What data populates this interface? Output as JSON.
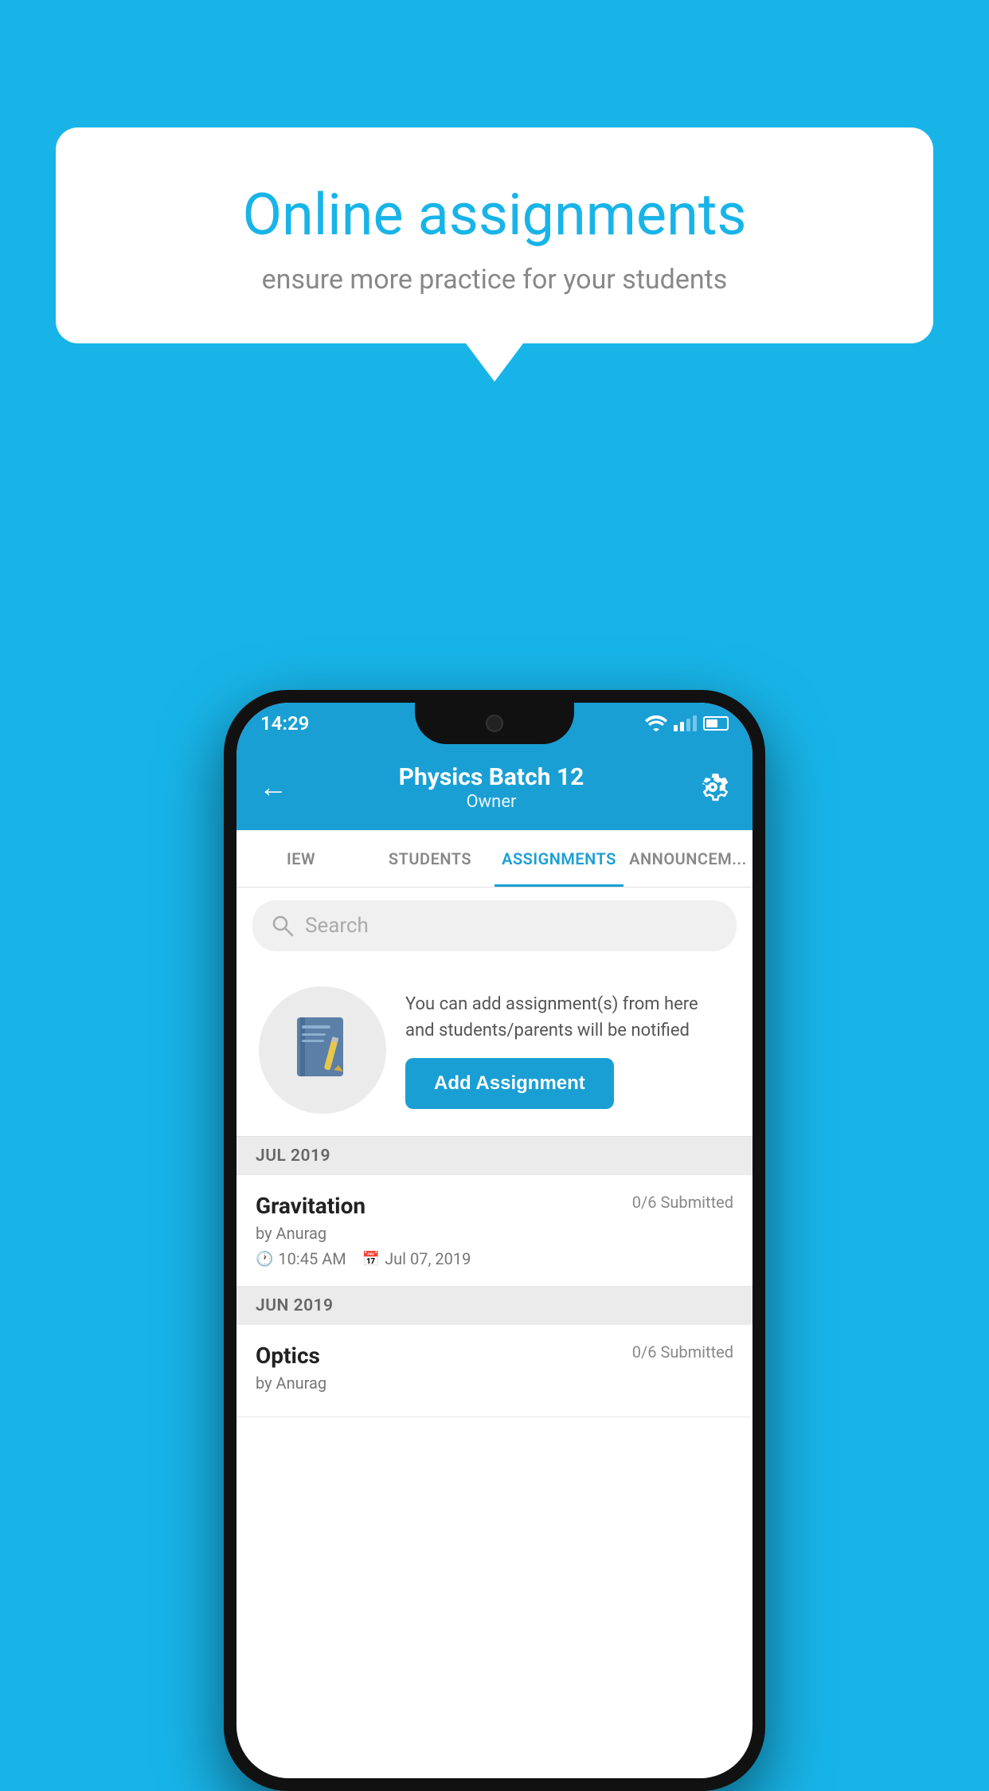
{
  "background_color": "#18b4e8",
  "speech_bubble": {
    "title": "Online assignments",
    "subtitle": "ensure more practice for your students"
  },
  "status_bar": {
    "time": "14:29",
    "wifi": true,
    "signal": true,
    "battery": true
  },
  "header": {
    "title": "Physics Batch 12",
    "subtitle": "Owner",
    "back_label": "←",
    "settings_label": "⚙"
  },
  "tabs": [
    {
      "label": "IEW",
      "active": false
    },
    {
      "label": "STUDENTS",
      "active": false
    },
    {
      "label": "ASSIGNMENTS",
      "active": true
    },
    {
      "label": "ANNOUNCEM...",
      "active": false
    }
  ],
  "search": {
    "placeholder": "Search"
  },
  "promo": {
    "text": "You can add assignment(s) from here and students/parents will be notified",
    "button_label": "Add Assignment"
  },
  "assignments": {
    "months": [
      {
        "label": "JUL 2019",
        "items": [
          {
            "title": "Gravitation",
            "submitted": "0/6 Submitted",
            "by": "by Anurag",
            "time": "10:45 AM",
            "date": "Jul 07, 2019"
          }
        ]
      },
      {
        "label": "JUN 2019",
        "items": [
          {
            "title": "Optics",
            "submitted": "0/6 Submitted",
            "by": "by Anurag",
            "time": "",
            "date": ""
          }
        ]
      }
    ]
  }
}
